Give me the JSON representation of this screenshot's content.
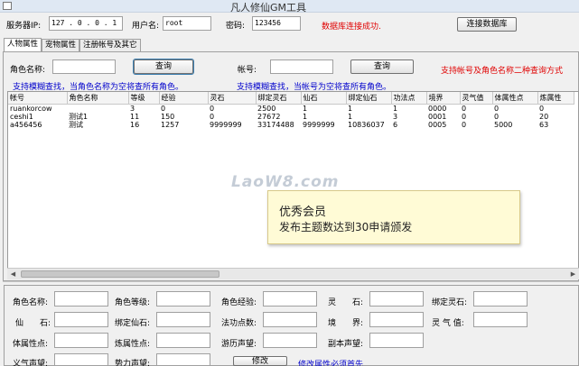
{
  "window": {
    "title": "凡人修仙GM工具"
  },
  "connection": {
    "server_ip_label": "服务器IP:",
    "server_ip_value": "127 . 0 . 0 . 1",
    "username_label": "用户名:",
    "username_value": "root",
    "password_label": "密码:",
    "password_value": "123456",
    "status_text": "数据库连接成功.",
    "connect_button": "连接数据库"
  },
  "tabs": [
    {
      "label": "人物属性"
    },
    {
      "label": "宠物属性"
    },
    {
      "label": "注册帐号及其它"
    }
  ],
  "search": {
    "role_name_label": "角色名称:",
    "role_name_value": "",
    "query_button_1": "查询",
    "account_label": "帐号:",
    "account_value": "",
    "query_button_2": "查询",
    "red_hint": "支持帐号及角色名称二种查询方式",
    "hint_role": "支持模糊查找，当角色名称为空将查所有角色。",
    "hint_account": "支持模糊查找，当帐号为空将查所有角色。"
  },
  "table": {
    "columns": [
      "帐号",
      "角色名称",
      "等级",
      "经验",
      "灵石",
      "绑定灵石",
      "仙石",
      "绑定仙石",
      "功法点",
      "境界",
      "灵气值",
      "体属性点",
      "炼属性"
    ],
    "rows": [
      [
        "ruankorcow",
        "",
        "3",
        "0",
        "0",
        "2500",
        "1",
        "1",
        "1",
        "0000",
        "0",
        "0",
        "0"
      ],
      [
        "ceshi1",
        "测试1",
        "11",
        "150",
        "0",
        "27672",
        "1",
        "1",
        "3",
        "0001",
        "0",
        "0",
        "20"
      ],
      [
        "a456456",
        "测试",
        "16",
        "1257",
        "9999999",
        "33174488",
        "9999999",
        "10836037",
        "6",
        "0005",
        "0",
        "5000",
        "63"
      ]
    ]
  },
  "watermark": "LaoW8.com",
  "tooltip": {
    "title": "优秀会员",
    "body": "发布主题数达到30申请颁发"
  },
  "editor": {
    "role_name": "角色名称:",
    "role_level": "角色等级:",
    "role_exp": "角色经验:",
    "lingshi": "灵　　石:",
    "bound_lingshi": "绑定灵石:",
    "xianshi": "仙　　石:",
    "bound_xianshi": "绑定仙石:",
    "skill_points": "法功点数:",
    "realm": "境　　界:",
    "lingqi": "灵 气 值:",
    "body_points": "体属性点:",
    "refine_points": "炼属性点:",
    "history_fame": "游历声望:",
    "dungeon_fame": "副本声望:",
    "yiqi_fame": "义气声望:",
    "power_fame": "势力声望:",
    "modify_button": "修改",
    "note_blue": "修改属性必须首先"
  }
}
